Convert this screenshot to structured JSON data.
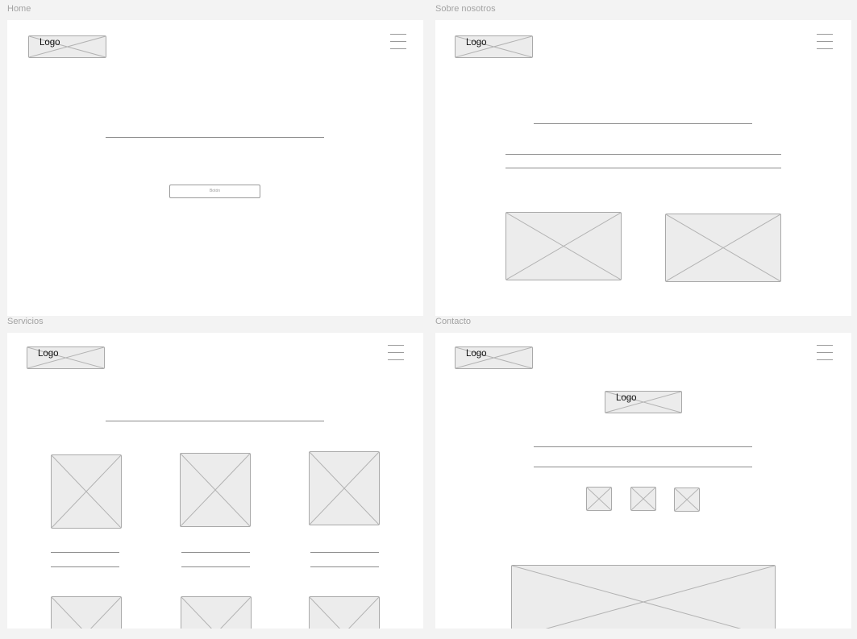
{
  "frames": [
    {
      "label": "Home",
      "logo_text": "Logo",
      "button_label": "Botón"
    },
    {
      "label": "Sobre nosotros",
      "logo_text": "Logo"
    },
    {
      "label": "Servicios",
      "logo_text": "Logo"
    },
    {
      "label": "Contacto",
      "logo_text": "Logo",
      "center_logo_text": "Logo"
    }
  ],
  "colors": {
    "canvas": "#f3f3f3",
    "frame": "#ffffff",
    "placeholder_fill": "#ececec",
    "placeholder_border": "#a9a9a9",
    "line": "#8c8c8c"
  },
  "icons": {
    "menu": "hamburger-menu-icon",
    "placeholder": "image-placeholder-icon"
  }
}
